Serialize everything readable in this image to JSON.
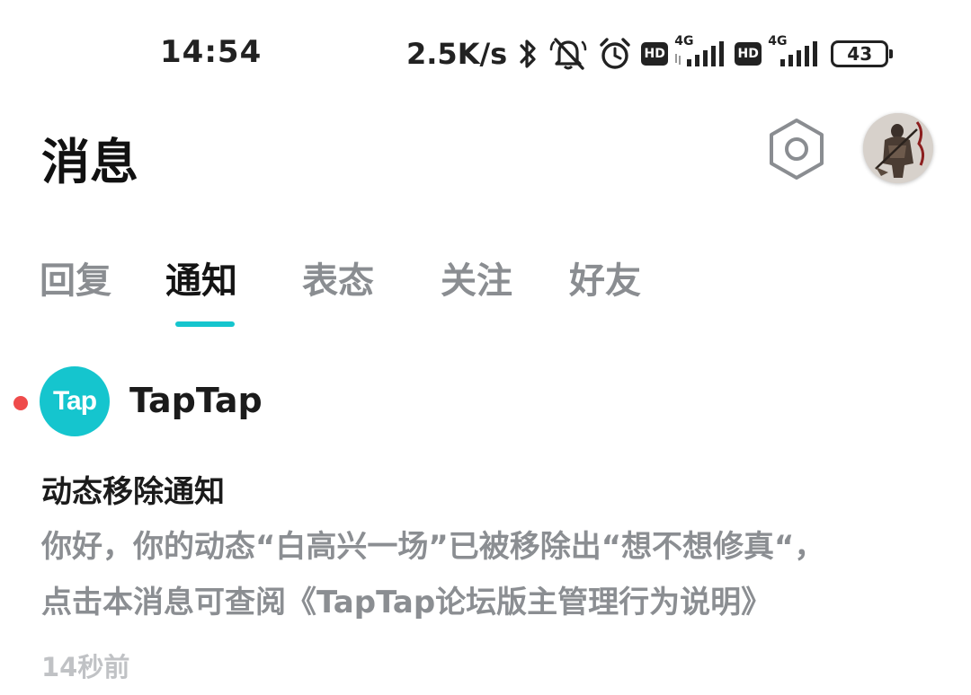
{
  "status_bar": {
    "time": "14:54",
    "network_speed": "2.5K/s",
    "hd_label_1": "HD",
    "hd_label_2": "HD",
    "signal_1_label": "4G",
    "signal_2_label": "4G",
    "battery_level": "43",
    "icons": [
      "bluetooth-icon",
      "mute-icon",
      "alarm-icon",
      "signal-icon",
      "battery-icon"
    ]
  },
  "header": {
    "title": "消息",
    "settings_icon": "hexagon-settings-icon",
    "avatar_icon": "user-avatar"
  },
  "tabs": [
    {
      "label": "回复",
      "active": false
    },
    {
      "label": "通知",
      "active": true
    },
    {
      "label": "表态",
      "active": false
    },
    {
      "label": "关注",
      "active": false
    },
    {
      "label": "好友",
      "active": false
    }
  ],
  "notification": {
    "unread": true,
    "logo_text": "Tap",
    "sender": "TapTap",
    "title": "动态移除通知",
    "body_line_1": "你好，你的动态“白高兴一场”已被移除出“想不想修真“，",
    "body_line_2": "点击本消息可查阅《TapTap论坛版主管理行为说明》",
    "time": "14秒前"
  },
  "colors": {
    "accent": "#15c5ce",
    "unread_dot": "#ef4b4b",
    "active_tab": "#141414",
    "inactive_tab": "#8a8d91",
    "body_text": "#8b8e92",
    "timestamp": "#c0c2c5"
  }
}
